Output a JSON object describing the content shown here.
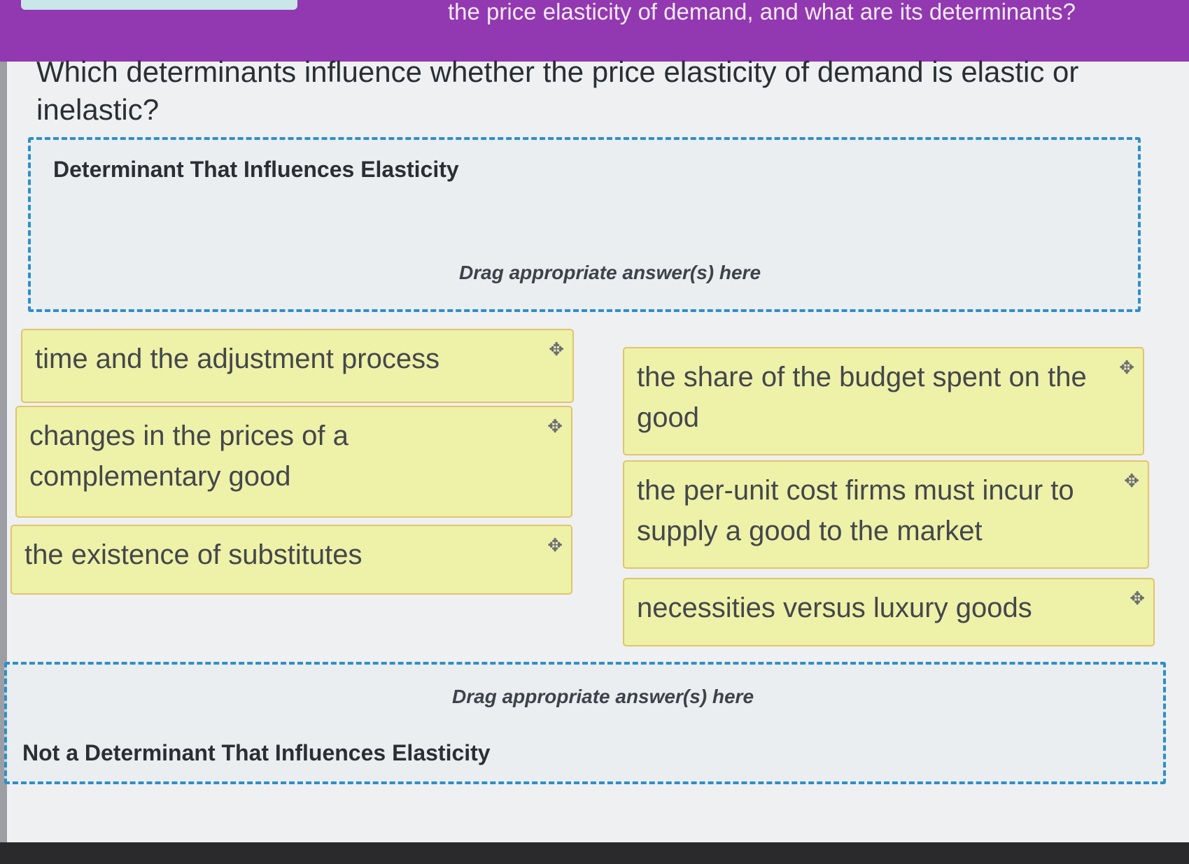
{
  "header": {
    "title": "the price elasticity of demand, and what are its determinants?"
  },
  "question": {
    "text": "Which determinants influence whether the price elasticity of demand is elastic or inelastic?"
  },
  "zones": {
    "top": {
      "heading": "Determinant That Influences Elasticity",
      "hint": "Drag appropriate answer(s) here"
    },
    "bottom": {
      "heading": "Not a Determinant That Influences Elasticity",
      "hint": "Drag appropriate answer(s) here"
    }
  },
  "answers": [
    {
      "label": "time and the adjustment process",
      "icon": "move-icon"
    },
    {
      "label": "changes in the prices of a complementary good",
      "icon": "move-icon"
    },
    {
      "label": "the existence of substitutes",
      "icon": "move-icon"
    },
    {
      "label": "the share of the budget spent on the good",
      "icon": "move-icon"
    },
    {
      "label": "the per-unit cost firms must incur to supply a good to the market",
      "icon": "move-icon"
    },
    {
      "label": "necessities versus luxury goods",
      "icon": "move-icon"
    }
  ],
  "icons": {
    "move": "✥"
  },
  "colors": {
    "header_bg": "#9238b0",
    "dropzone_border": "#2e8fc7",
    "chip_bg": "#eef1a8",
    "chip_border": "#e2c46a"
  }
}
